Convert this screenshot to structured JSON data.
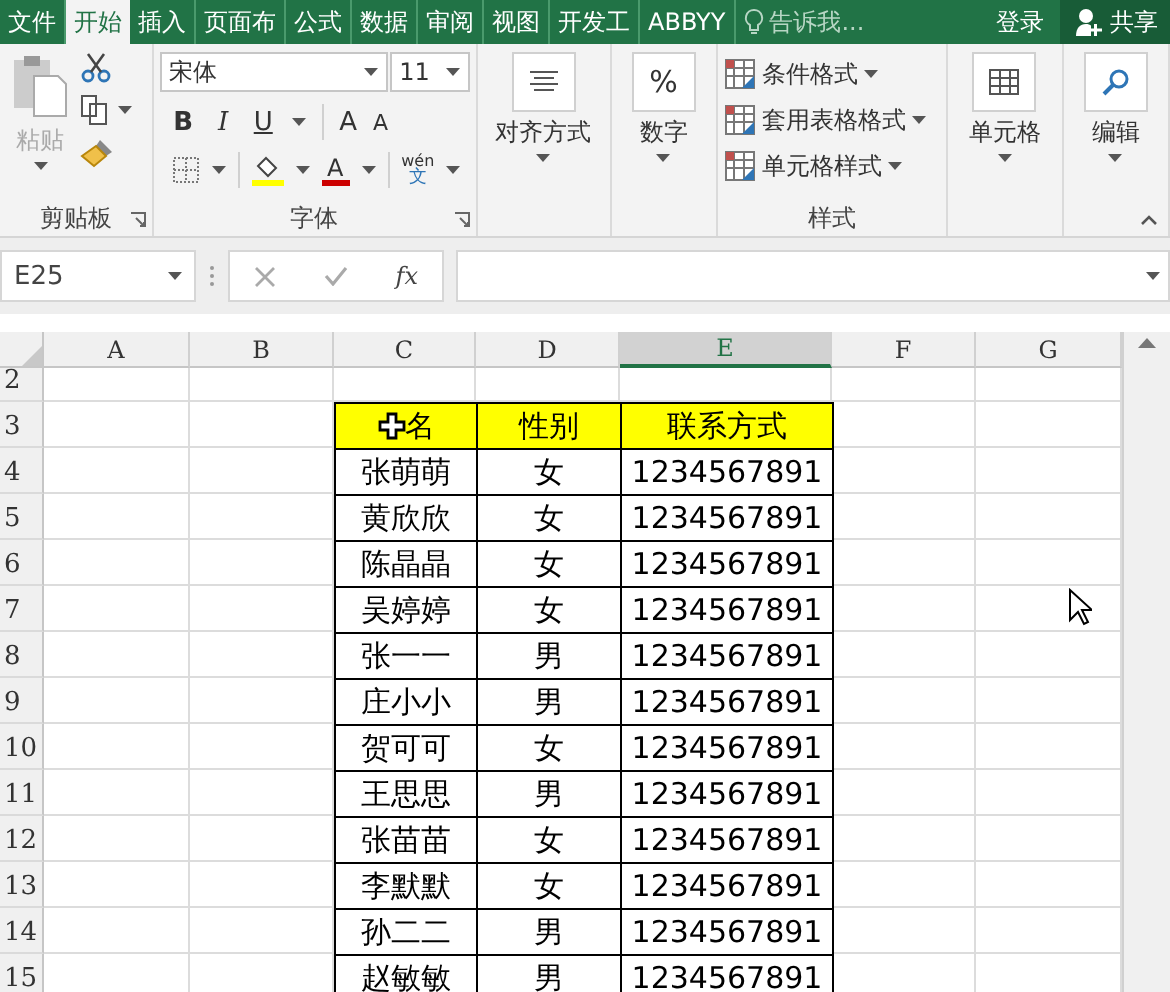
{
  "ribbon_tabs": [
    {
      "label": "文件",
      "selected": false
    },
    {
      "label": "开始",
      "selected": true
    },
    {
      "label": "插入",
      "selected": false
    },
    {
      "label": "页面布",
      "selected": false
    },
    {
      "label": "公式",
      "selected": false
    },
    {
      "label": "数据",
      "selected": false
    },
    {
      "label": "审阅",
      "selected": false
    },
    {
      "label": "视图",
      "selected": false
    },
    {
      "label": "开发工",
      "selected": false
    },
    {
      "label": "ABBYY",
      "selected": false
    }
  ],
  "tell_me": {
    "placeholder": "告诉我..."
  },
  "sign_in": "登录",
  "share": "共享",
  "clipboard": {
    "paste": "粘贴",
    "paste_disabled": true,
    "label": "剪贴板"
  },
  "font": {
    "name": "宋体",
    "size": "11",
    "bold": "B",
    "italic": "I",
    "underline": "U",
    "grow": "A",
    "shrink": "A",
    "font_color_letter": "A",
    "phonetic_top": "wén",
    "phonetic_bottom": "文",
    "label": "字体"
  },
  "alignment": {
    "label": "对齐方式"
  },
  "number": {
    "symbol": "%",
    "label": "数字"
  },
  "styles": {
    "items": [
      "条件格式",
      "套用表格格式",
      "单元格样式"
    ],
    "label": "样式"
  },
  "cells": {
    "label": "单元格"
  },
  "editing": {
    "label": "编辑"
  },
  "formula_bar": {
    "name_box": "E25",
    "fx": "fx"
  },
  "columns": [
    {
      "label": "A",
      "selected": false
    },
    {
      "label": "B",
      "selected": false
    },
    {
      "label": "C",
      "selected": false
    },
    {
      "label": "D",
      "selected": false
    },
    {
      "label": "E",
      "selected": true
    },
    {
      "label": "F",
      "selected": false
    },
    {
      "label": "G",
      "selected": false
    }
  ],
  "rows": [
    "2",
    "3",
    "4",
    "5",
    "6",
    "7",
    "8",
    "9",
    "10",
    "11",
    "12",
    "13",
    "14",
    "15"
  ],
  "table": {
    "header": [
      "名",
      "性别",
      "联系方式"
    ],
    "rows": [
      [
        "张萌萌",
        "女",
        "1234567891"
      ],
      [
        "黄欣欣",
        "女",
        "1234567891"
      ],
      [
        "陈晶晶",
        "女",
        "1234567891"
      ],
      [
        "吴婷婷",
        "女",
        "1234567891"
      ],
      [
        "张一一",
        "男",
        "1234567891"
      ],
      [
        "庄小小",
        "男",
        "1234567891"
      ],
      [
        "贺可可",
        "女",
        "1234567891"
      ],
      [
        "王思思",
        "男",
        "1234567891"
      ],
      [
        "张苗苗",
        "女",
        "1234567891"
      ],
      [
        "李默默",
        "女",
        "1234567891"
      ],
      [
        "孙二二",
        "男",
        "1234567891"
      ],
      [
        "赵敏敏",
        "男",
        "1234567891"
      ]
    ]
  }
}
